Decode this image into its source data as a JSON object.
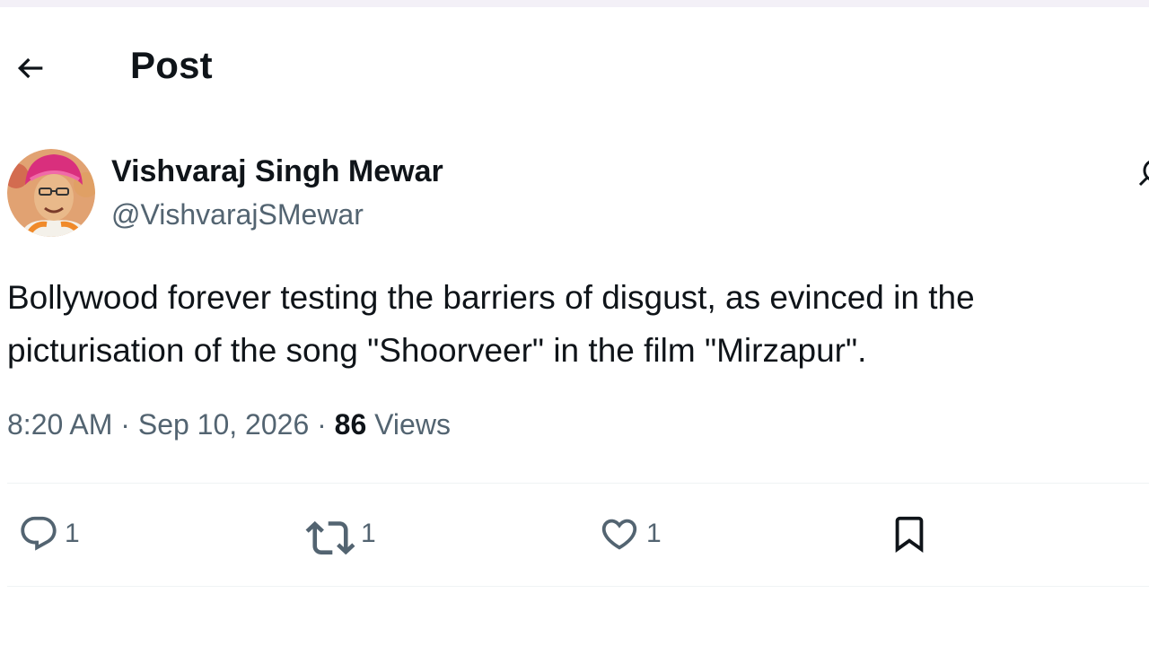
{
  "header": {
    "title": "Post",
    "back_icon": "arrow-left-icon"
  },
  "post": {
    "author": {
      "name": "Vishvaraj Singh Mewar",
      "handle": "@VishvarajSMewar",
      "avatar_icon": "user-avatar"
    },
    "text_line1": "Bollywood forever testing the barriers of disgust, as evinced in the",
    "text_line2": "picturisation of the song \"Shoorveer\" in the film \"Mirzapur\".",
    "time": "8:20 AM",
    "separator": "·",
    "date": "Sep 10, 2026",
    "views_count": "86",
    "views_label": "Views"
  },
  "actions": {
    "reply": {
      "icon": "reply-icon",
      "count": "1"
    },
    "retweet": {
      "icon": "retweet-icon",
      "count": "1"
    },
    "like": {
      "icon": "heart-icon",
      "count": "1"
    },
    "bookmark": {
      "icon": "bookmark-icon"
    }
  },
  "colors": {
    "text_primary": "#0f1419",
    "text_secondary": "#536471",
    "divider": "#eff3f4",
    "top_strip": "#f3f0f7"
  }
}
